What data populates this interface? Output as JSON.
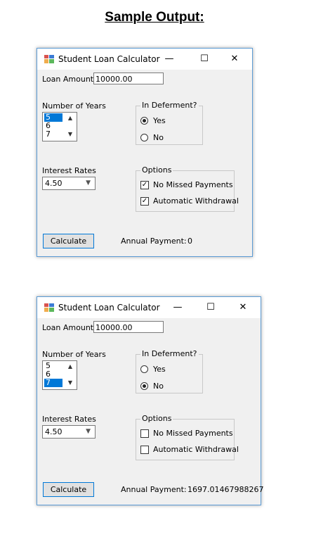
{
  "heading": "Sample Output:",
  "windows": [
    {
      "title": "Student Loan Calculator",
      "loan_amount_label": "Loan Amount",
      "loan_amount_value": "10000.00",
      "years_label": "Number of Years",
      "years_items": [
        "5",
        "6",
        "7"
      ],
      "years_selected": "5",
      "deferment_label": "In Deferment?",
      "yes_label": "Yes",
      "no_label": "No",
      "deferment_selected": "Yes",
      "interest_label": "Interest Rates",
      "interest_value": "4.50",
      "options_label": "Options",
      "no_missed_label": "No Missed Payments",
      "no_missed_checked": true,
      "auto_withdrawal_label": "Automatic Withdrawal",
      "auto_withdrawal_checked": true,
      "calculate_label": "Calculate",
      "annual_payment_label": "Annual Payment:",
      "annual_payment_value": "0"
    },
    {
      "title": "Student Loan Calculator",
      "loan_amount_label": "Loan Amount",
      "loan_amount_value": "10000.00",
      "years_label": "Number of Years",
      "years_items": [
        "5",
        "6",
        "7"
      ],
      "years_selected": "7",
      "deferment_label": "In Deferment?",
      "yes_label": "Yes",
      "no_label": "No",
      "deferment_selected": "No",
      "interest_label": "Interest Rates",
      "interest_value": "4.50",
      "options_label": "Options",
      "no_missed_label": "No Missed Payments",
      "no_missed_checked": false,
      "auto_withdrawal_label": "Automatic Withdrawal",
      "auto_withdrawal_checked": false,
      "calculate_label": "Calculate",
      "annual_payment_label": "Annual Payment:",
      "annual_payment_value": "1697.01467988267"
    }
  ]
}
